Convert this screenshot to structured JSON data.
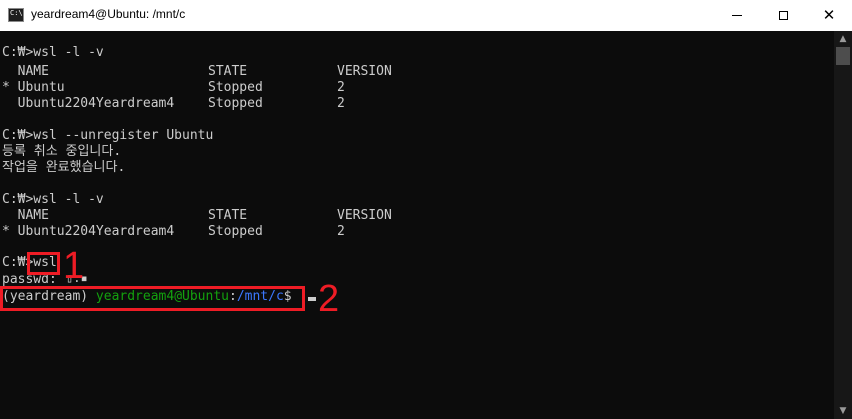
{
  "window": {
    "title": "yeardream4@Ubuntu: /mnt/c",
    "icon": "console-app-icon",
    "icon_glyph": "C:\\",
    "controls": {
      "minimize": "minimize-icon",
      "maximize": "maximize-icon",
      "close": "close-icon",
      "close_glyph": "✕"
    }
  },
  "console": {
    "lines": [
      "C:₩>wsl -l -v",
      "  NAME",
      "* Ubuntu",
      "  Ubuntu2204Yeardream4",
      "",
      "C:₩>wsl --unregister Ubuntu",
      "등록 취소 중입니다.",
      "작업을 완료했습니다.",
      "",
      "C:₩>wsl -l -v",
      "  NAME",
      "* Ubuntu2204Yeardream4",
      "",
      "C:₩>wsl",
      "passwd: "
    ],
    "table1": {
      "headers": [
        "STATE",
        "VERSION"
      ],
      "rows": [
        [
          "Stopped",
          "2"
        ],
        [
          "Stopped",
          "2"
        ]
      ]
    },
    "table2": {
      "headers": [
        "STATE",
        "VERSION"
      ],
      "rows": [
        [
          "Stopped",
          "2"
        ]
      ]
    },
    "prompt": {
      "env": "(yeardream) ",
      "user_host": "yeardream4@Ubuntu",
      "sep": ":",
      "path": "/mnt/c",
      "symbol": "$"
    },
    "password_mark": "▯:▪",
    "annotations": [
      "1",
      "2"
    ]
  },
  "scrollbar": {
    "up_glyph": "▲",
    "down_glyph": "▼"
  },
  "colors": {
    "background": "#0c0c0c",
    "text": "#cccccc",
    "prompt_green": "#13a10e",
    "prompt_blue": "#3b78ff",
    "annotation_red": "#ee1c25"
  }
}
